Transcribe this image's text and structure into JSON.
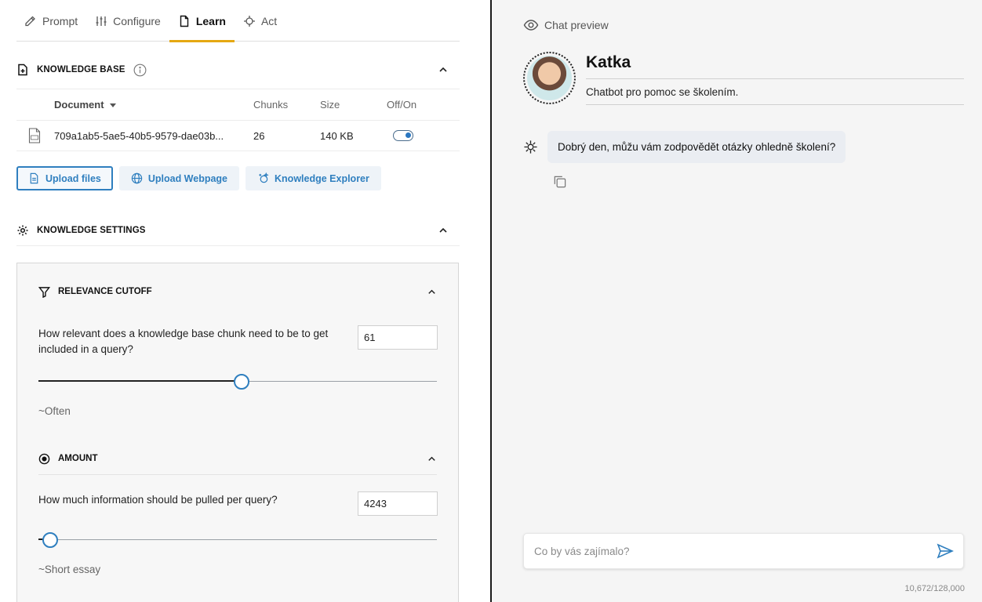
{
  "tabs": [
    {
      "label": "Prompt",
      "icon": "pencil-icon",
      "active": false
    },
    {
      "label": "Configure",
      "icon": "sliders-icon",
      "active": false
    },
    {
      "label": "Learn",
      "icon": "document-icon",
      "active": true
    },
    {
      "label": "Act",
      "icon": "target-icon",
      "active": false
    }
  ],
  "knowledge_base": {
    "title": "KNOWLEDGE BASE",
    "columns": {
      "document": "Document",
      "chunks": "Chunks",
      "size": "Size",
      "toggle": "Off/On"
    },
    "rows": [
      {
        "document": "709a1ab5-5ae5-40b5-9579-dae03b...",
        "chunks": "26",
        "size": "140 KB",
        "enabled": true
      }
    ]
  },
  "buttons": {
    "upload_files": "Upload files",
    "upload_webpage": "Upload Webpage",
    "knowledge_explorer": "Knowledge Explorer"
  },
  "knowledge_settings": {
    "title": "KNOWLEDGE SETTINGS",
    "relevance": {
      "title": "RELEVANCE CUTOFF",
      "question": "How relevant does a knowledge base chunk need to be to get included in a query?",
      "value": "61",
      "slider_fraction": 0.51,
      "hint": "~Often"
    },
    "amount": {
      "title": "AMOUNT",
      "question": "How much information should be pulled per query?",
      "value": "4243",
      "slider_fraction": 0.03,
      "hint": "~Short essay"
    }
  },
  "preview": {
    "title": "Chat preview",
    "bot_name": "Katka",
    "bot_description": "Chatbot pro pomoc se školením.",
    "greeting": "Dobrý den, můžu vám zodpovědět otázky ohledně školení?",
    "input_placeholder": "Co by vás zajímalo?",
    "token_count": "10,672/128,000"
  },
  "colors": {
    "accent_tab": "#e5a812",
    "link_blue": "#2f7fbf",
    "bubble_bg": "#eaedf2"
  }
}
